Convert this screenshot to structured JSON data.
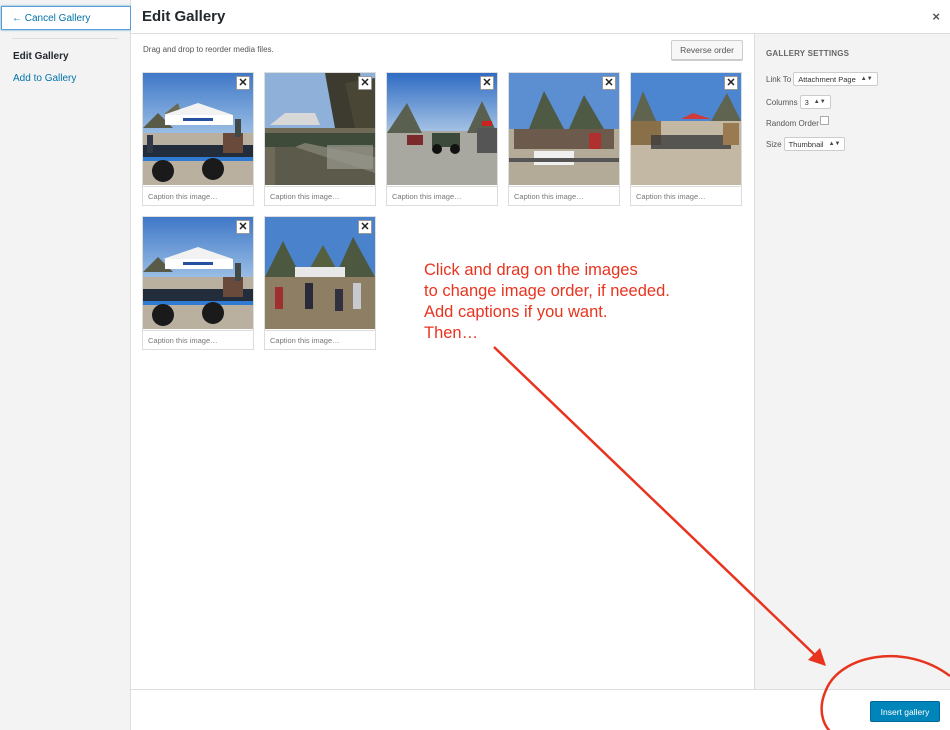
{
  "sidebar": {
    "cancel_label": "← Cancel Gallery",
    "items": [
      {
        "label": "Edit Gallery",
        "active": true
      },
      {
        "label": "Add to Gallery",
        "active": false
      }
    ]
  },
  "header": {
    "title": "Edit Gallery",
    "close_icon": "×"
  },
  "main": {
    "instructions": "Drag and drop to reorder media files.",
    "reverse_order_label": "Reverse order",
    "remove_icon": "✕",
    "images": [
      {
        "caption_placeholder": "Caption this image…"
      },
      {
        "caption_placeholder": "Caption this image…"
      },
      {
        "caption_placeholder": "Caption this image…"
      },
      {
        "caption_placeholder": "Caption this image…"
      },
      {
        "caption_placeholder": "Caption this image…"
      },
      {
        "caption_placeholder": "Caption this image…"
      },
      {
        "caption_placeholder": "Caption this image…"
      }
    ]
  },
  "settings": {
    "heading": "GALLERY SETTINGS",
    "link_to_label": "Link To",
    "link_to_value": "Attachment Page",
    "columns_label": "Columns",
    "columns_value": "3",
    "random_order_label": "Random Order",
    "random_order_checked": false,
    "size_label": "Size",
    "size_value": "Thumbnail",
    "select_arrow": "▲▼"
  },
  "toolbar": {
    "insert_label": "Insert gallery"
  },
  "annotation": {
    "lines": [
      "Click and drag on the images",
      "to change image order, if needed.",
      "Add captions if you want.",
      "Then…"
    ],
    "color": "#e8341f"
  },
  "colors": {
    "accent": "#0085ba",
    "link": "#0073aa",
    "sidebar_bg": "#f3f3f3"
  }
}
